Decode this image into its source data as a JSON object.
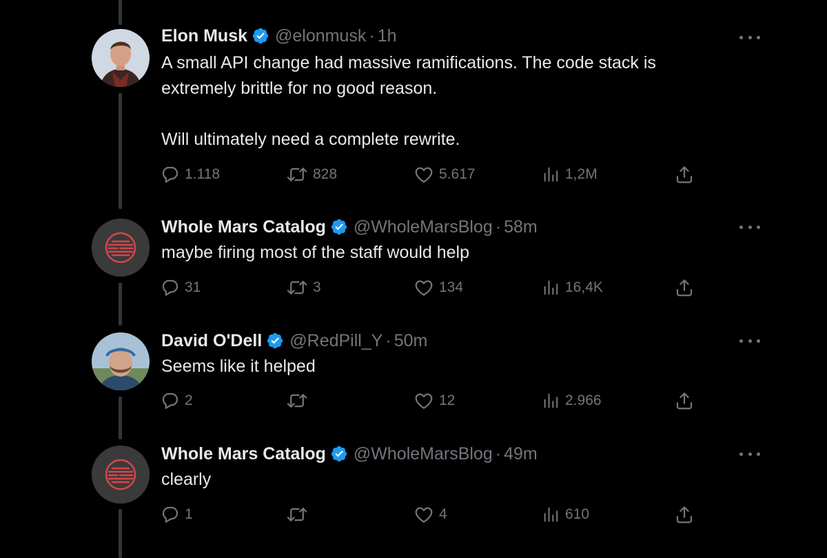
{
  "tweets": [
    {
      "name": "Elon Musk",
      "handle": "@elonmusk",
      "time": "1h",
      "text": [
        "A small API change had massive ramifications. The code stack is",
        "extremely brittle for no good reason.",
        "Will ultimately need a complete rewrite."
      ],
      "replies": "1.118",
      "reposts": "828",
      "likes": "5.617",
      "views": "1,2M"
    },
    {
      "name": "Whole Mars Catalog",
      "handle": "@WholeMarsBlog",
      "time": "58m",
      "text": [
        "maybe firing most of the staff would help"
      ],
      "replies": "31",
      "reposts": "3",
      "likes": "134",
      "views": "16,4K"
    },
    {
      "name": "David O'Dell",
      "handle": "@RedPill_Y",
      "time": "50m",
      "text": [
        "Seems like it helped"
      ],
      "replies": "2",
      "reposts": "",
      "likes": "12",
      "views": "2.966"
    },
    {
      "name": "Whole Mars Catalog",
      "handle": "@WholeMarsBlog",
      "time": "49m",
      "text": [
        "clearly"
      ],
      "replies": "1",
      "reposts": "",
      "likes": "4",
      "views": "610"
    }
  ],
  "separator": "·",
  "colors": {
    "background": "#000000",
    "text": "#e7e9ea",
    "secondary": "#71767b",
    "verified": "#1d9bf0",
    "thread_line": "#333639"
  },
  "icons": [
    "verified-badge-icon",
    "more-icon",
    "reply-icon",
    "repost-icon",
    "like-icon",
    "views-icon",
    "share-icon"
  ]
}
